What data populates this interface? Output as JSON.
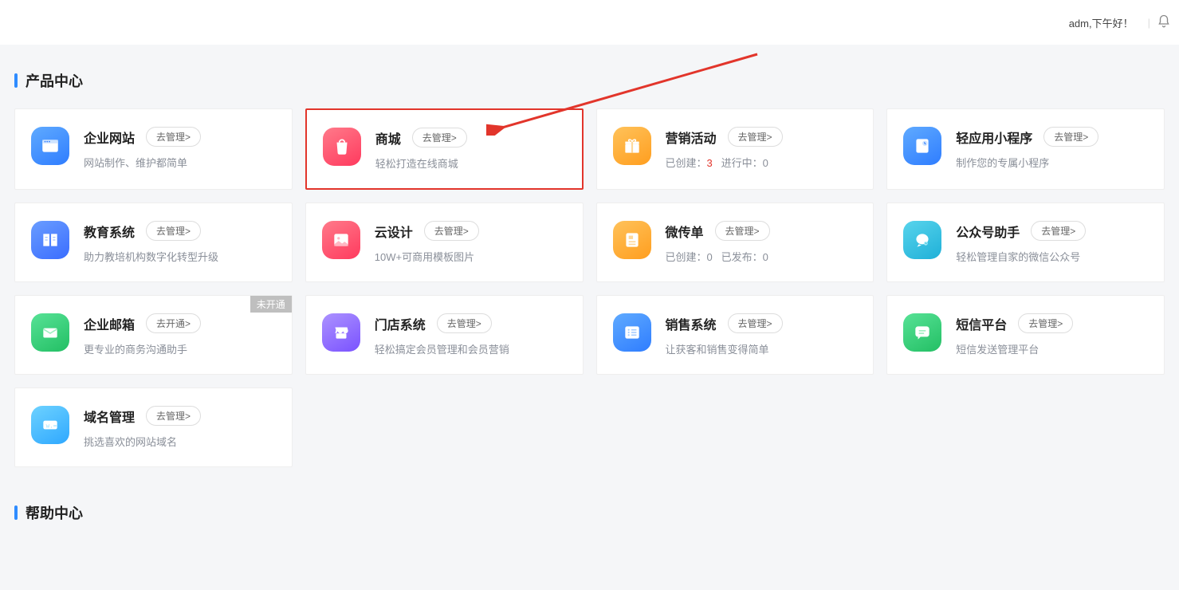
{
  "header": {
    "greeting": "adm,下午好！"
  },
  "sections": {
    "products_title": "产品中心",
    "help_title": "帮助中心"
  },
  "cards": {
    "r0c0": {
      "title": "企业网站",
      "btn": "去管理>",
      "desc": "网站制作、维护都简单",
      "icon_bg": "#3a95ff"
    },
    "r0c1": {
      "title": "商城",
      "btn": "去管理>",
      "desc": "轻松打造在线商城",
      "icon_bg": "#ff4d6a"
    },
    "r0c2": {
      "title": "营销活动",
      "btn": "去管理>",
      "desc_prefix1": "已创建：",
      "desc_val1": "3",
      "desc_prefix2": "进行中：",
      "desc_val2": "0",
      "icon_bg": "#ffb024"
    },
    "r0c3": {
      "title": "轻应用小程序",
      "btn": "去管理>",
      "desc": "制作您的专属小程序",
      "icon_bg": "#3a95ff"
    },
    "r1c0": {
      "title": "教育系统",
      "btn": "去管理>",
      "desc": "助力教培机构数字化转型升级",
      "icon_bg": "#4a86ff"
    },
    "r1c1": {
      "title": "云设计",
      "btn": "去管理>",
      "desc": "10W+可商用模板图片",
      "icon_bg": "#ff4d6a"
    },
    "r1c2": {
      "title": "微传单",
      "btn": "去管理>",
      "desc_prefix1": "已创建：",
      "desc_val1": "0",
      "desc_prefix2": "已发布：",
      "desc_val2": "0",
      "icon_bg": "#ffb024"
    },
    "r1c3": {
      "title": "公众号助手",
      "btn": "去管理>",
      "desc": "轻松管理自家的微信公众号",
      "icon_bg": "#2fc1e0"
    },
    "r2c0": {
      "title": "企业邮箱",
      "btn": "去开通>",
      "desc": "更专业的商务沟通助手",
      "icon_bg": "#35c971",
      "corner": "未开通"
    },
    "r2c1": {
      "title": "门店系统",
      "btn": "去管理>",
      "desc": "轻松搞定会员管理和会员营销",
      "icon_bg": "#8b6bff"
    },
    "r2c2": {
      "title": "销售系统",
      "btn": "去管理>",
      "desc": "让获客和销售变得简单",
      "icon_bg": "#3a95ff"
    },
    "r2c3": {
      "title": "短信平台",
      "btn": "去管理>",
      "desc": "短信发送管理平台",
      "icon_bg": "#35c971"
    },
    "r3c0": {
      "title": "域名管理",
      "btn": "去管理>",
      "desc": "挑选喜欢的网站域名",
      "icon_bg": "#3fbbff"
    }
  }
}
